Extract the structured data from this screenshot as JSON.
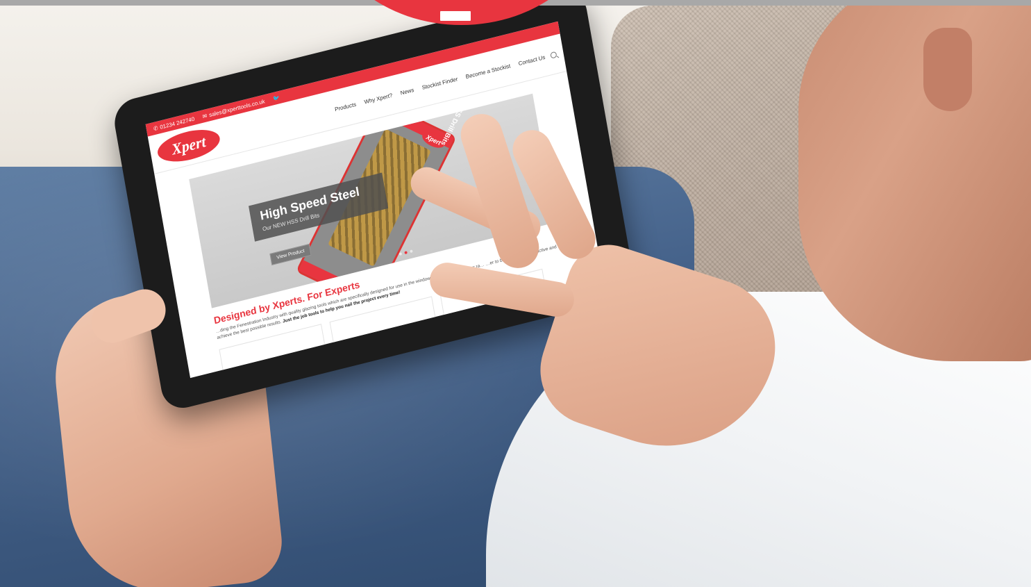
{
  "site": {
    "phone": "01234 242740",
    "email": "sales@xperttools.co.uk",
    "logo_text": "Xpert",
    "nav": [
      "Products",
      "Why Xpert?",
      "News",
      "Stockist Finder",
      "Become a Stockist",
      "Contact Us"
    ]
  },
  "hero": {
    "title": "High Speed Steel",
    "subtitle": "Our NEW HSS Drill Bits",
    "button": "View Product",
    "pack_logo": "Xpert",
    "pack_label": "HSS Drill Bits",
    "slide_count": 3,
    "active_slide": 1
  },
  "section": {
    "title": "Designed by Xperts. For Experts",
    "text_1": "…ding the Fenestration Industry with quality glazing tools which are specifically designed for use in the window and door industry. Our ra… …er to become more productive and achieve the best possible results.",
    "text_bold": "Just the job tools to help you nail the project every time!"
  },
  "colors": {
    "brand_red": "#e8353f",
    "tablet_bezel": "#1c1c1c"
  }
}
